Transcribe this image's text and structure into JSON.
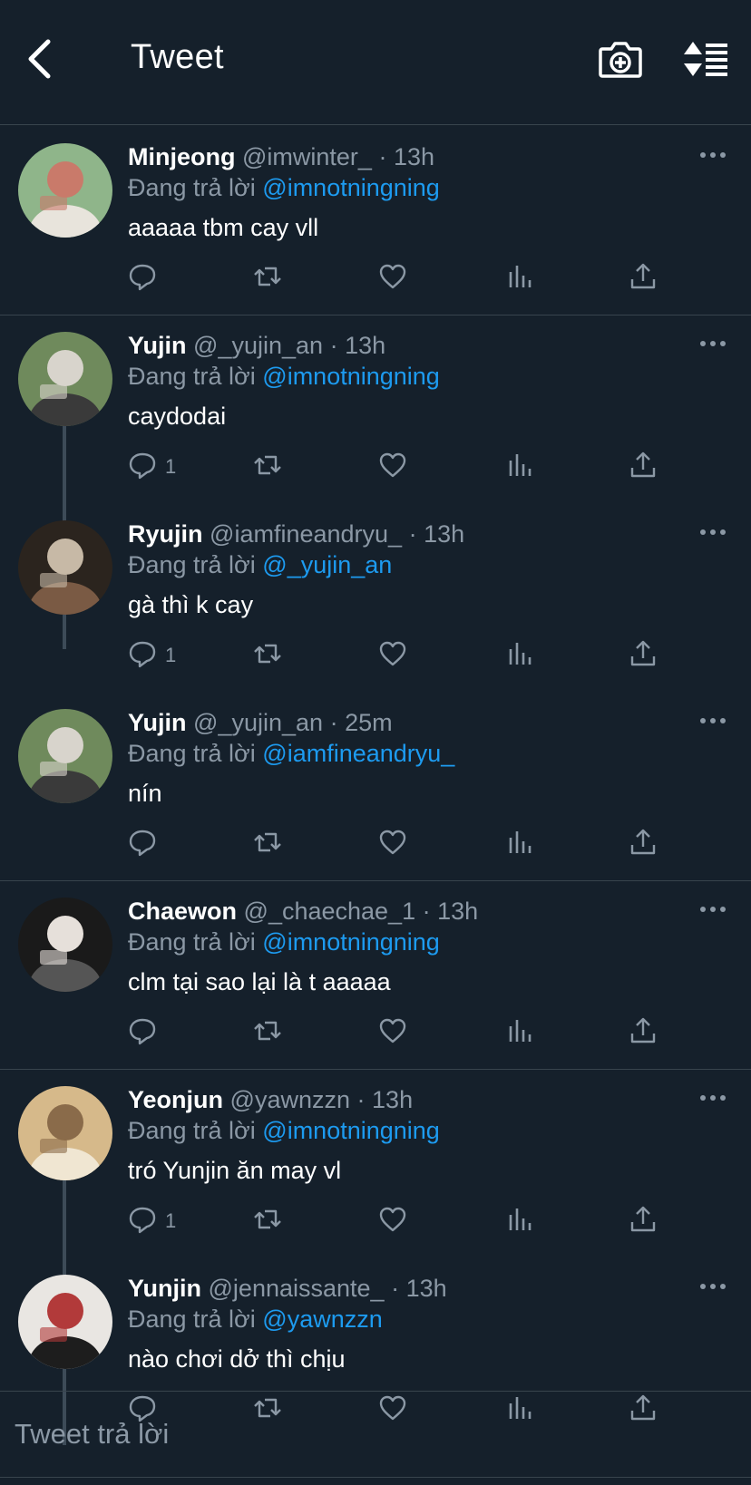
{
  "header": {
    "title": "Tweet"
  },
  "tweets": [
    {
      "name": "Minjeong",
      "handle": "@imwinter_",
      "time": "13h",
      "reply_prefix": "Đang trả lời",
      "reply_to": "@imnotningning",
      "text": "aaaaa tbm cay vll",
      "reply_count": ""
    },
    {
      "name": "Yujin",
      "handle": "@_yujin_an",
      "time": "13h",
      "reply_prefix": "Đang trả lời",
      "reply_to": "@imnotningning",
      "text": "caydodai",
      "reply_count": "1"
    },
    {
      "name": "Ryujin",
      "handle": "@iamfineandryu_",
      "time": "13h",
      "reply_prefix": "Đang trả lời",
      "reply_to": "@_yujin_an",
      "text": "gà thì k cay",
      "reply_count": "1"
    },
    {
      "name": "Yujin",
      "handle": "@_yujin_an",
      "time": "25m",
      "reply_prefix": "Đang trả lời",
      "reply_to": "@iamfineandryu_",
      "text": "nín",
      "reply_count": ""
    },
    {
      "name": "Chaewon",
      "handle": "@_chaechae_1",
      "time": "13h",
      "reply_prefix": "Đang trả lời",
      "reply_to": "@imnotningning",
      "text": "clm tại sao lại là t aaaaa",
      "reply_count": ""
    },
    {
      "name": "Yeonjun",
      "handle": "@yawnzzn",
      "time": "13h",
      "reply_prefix": "Đang trả lời",
      "reply_to": "@imnotningning",
      "text": "tró Yunjin ăn may vl",
      "reply_count": "1"
    },
    {
      "name": "Yunjin",
      "handle": "@jennaissante_",
      "time": "13h",
      "reply_prefix": "Đang trả lời",
      "reply_to": "@yawnzzn",
      "text": "nào chơi dở thì chịu",
      "reply_count": ""
    }
  ],
  "composer": {
    "placeholder": "Tweet trả lời"
  },
  "icons": {
    "back": "chevron-left-icon",
    "camera": "camera-plus-icon",
    "sort": "sort-icon",
    "reply": "reply-bubble-icon",
    "retweet": "retweet-icon",
    "like": "heart-icon",
    "analytics": "analytics-bars-icon",
    "share": "share-upload-icon",
    "more": "more-dots-icon"
  },
  "colors": {
    "background": "#15202b",
    "separator": "#38444d",
    "muted": "#8b98a5",
    "mention": "#1d9bf0",
    "text": "#ffffff"
  }
}
